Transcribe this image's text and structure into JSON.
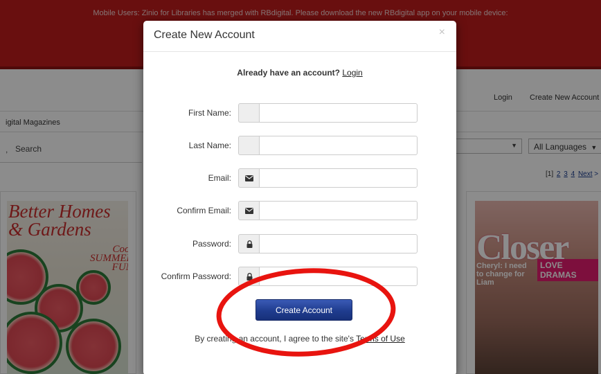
{
  "banner": {
    "text": "Mobile Users: Zinio for Libraries has merged with RBdigital. Please download the new RBdigital app on your mobile device:"
  },
  "header": {
    "login_link": "Login",
    "create_account_link": "Create New Account"
  },
  "breadcrumb": {
    "label": "igital Magazines"
  },
  "search": {
    "label": "Search"
  },
  "filters": {
    "language": "All Languages"
  },
  "pagination": {
    "current": "[1]",
    "pages": [
      "2",
      "3",
      "4"
    ],
    "next": "Next"
  },
  "modal": {
    "title": "Create New Account",
    "close": "×",
    "already_prefix": "Already have an account? ",
    "login_link": "Login",
    "fields": [
      {
        "label": "First Name:",
        "icon": "",
        "value": ""
      },
      {
        "label": "Last Name:",
        "icon": "",
        "value": ""
      },
      {
        "label": "Email:",
        "icon": "envelope-icon",
        "value": ""
      },
      {
        "label": "Confirm Email:",
        "icon": "envelope-icon",
        "value": ""
      },
      {
        "label": "Password:",
        "icon": "lock-icon",
        "value": ""
      },
      {
        "label": "Confirm Password:",
        "icon": "lock-icon",
        "value": ""
      }
    ],
    "submit_label": "Create Account",
    "terms_prefix": "By creating an account, I agree to the site's ",
    "terms_link": "Terms of Use"
  },
  "covers": {
    "left": {
      "title": "Better Homes & Gardens",
      "tagline": "Cool SUMMER FUN"
    },
    "right": {
      "title": "Closer",
      "tag": "LOVE DRAMAS",
      "headline": "Cheryl: I need to change for Liam"
    }
  },
  "colors": {
    "banner": "#c01c1c",
    "submit_button": "#1f3c8e",
    "annotation": "#e8140f"
  }
}
